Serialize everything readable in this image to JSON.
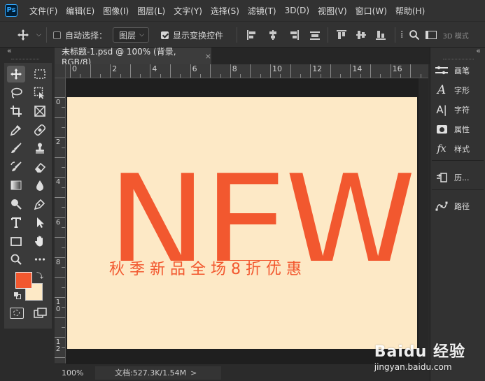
{
  "app": {
    "logo": "Ps"
  },
  "menu": [
    "文件(F)",
    "编辑(E)",
    "图像(I)",
    "图层(L)",
    "文字(Y)",
    "选择(S)",
    "滤镜(T)",
    "3D(D)",
    "视图(V)",
    "窗口(W)",
    "帮助(H)"
  ],
  "options": {
    "auto_select_label": "自动选择：",
    "auto_select_checked": false,
    "layer_select_value": "图层",
    "show_transform_label": "显示变换控件",
    "show_transform_checked": true,
    "mode_3d_label": "3D 模式"
  },
  "collapse_glyph": "«",
  "document": {
    "tab_title": "未标题-1.psd @ 100% (背景, RGB/8)",
    "close_glyph": "×",
    "artwork": {
      "big_word": "NEW",
      "promo_text": "秋季新品全场8折优惠",
      "background_color": "#fde9c6",
      "accent_color": "#f2582f"
    }
  },
  "rulers": {
    "horizontal_labels": [
      "0",
      "2",
      "4",
      "6",
      "8",
      "10",
      "12",
      "14",
      "16"
    ],
    "vertical_labels": [
      "0",
      "2",
      "4",
      "6",
      "8",
      "1 0",
      "1 2"
    ]
  },
  "right_panel": {
    "items": [
      {
        "icon": "brush-settings-icon",
        "label": "画笔"
      },
      {
        "icon": "character-icon",
        "label": "字形"
      },
      {
        "icon": "glyphs-icon",
        "label": "字符"
      },
      {
        "icon": "properties-icon",
        "label": "属性"
      },
      {
        "icon": "styles-icon",
        "label": "样式"
      },
      {
        "icon": "history-icon",
        "label": "历..."
      },
      {
        "icon": "paths-icon",
        "label": "路径"
      }
    ]
  },
  "toolbox": {
    "foreground_color": "#f2582f",
    "background_color": "#fde9c6"
  },
  "status": {
    "zoom": "100%",
    "doc_info": "文档:527.3K/1.54M",
    "arrow": ">"
  },
  "watermark": {
    "brand": "Baidu 经验",
    "url": "jingyan.baidu.com"
  }
}
